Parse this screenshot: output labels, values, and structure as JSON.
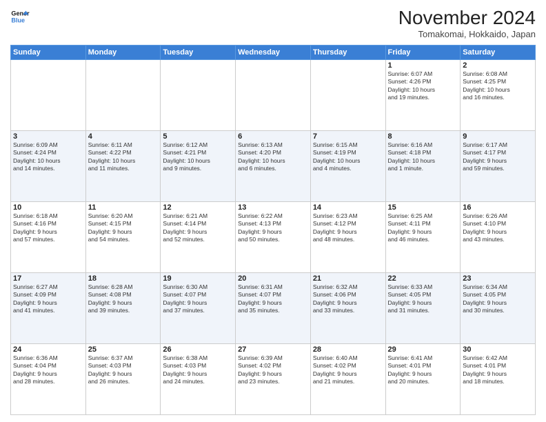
{
  "logo": {
    "line1": "General",
    "line2": "Blue"
  },
  "title": "November 2024",
  "location": "Tomakomai, Hokkaido, Japan",
  "days_of_week": [
    "Sunday",
    "Monday",
    "Tuesday",
    "Wednesday",
    "Thursday",
    "Friday",
    "Saturday"
  ],
  "weeks": [
    [
      {
        "day": "",
        "info": ""
      },
      {
        "day": "",
        "info": ""
      },
      {
        "day": "",
        "info": ""
      },
      {
        "day": "",
        "info": ""
      },
      {
        "day": "",
        "info": ""
      },
      {
        "day": "1",
        "info": "Sunrise: 6:07 AM\nSunset: 4:26 PM\nDaylight: 10 hours\nand 19 minutes."
      },
      {
        "day": "2",
        "info": "Sunrise: 6:08 AM\nSunset: 4:25 PM\nDaylight: 10 hours\nand 16 minutes."
      }
    ],
    [
      {
        "day": "3",
        "info": "Sunrise: 6:09 AM\nSunset: 4:24 PM\nDaylight: 10 hours\nand 14 minutes."
      },
      {
        "day": "4",
        "info": "Sunrise: 6:11 AM\nSunset: 4:22 PM\nDaylight: 10 hours\nand 11 minutes."
      },
      {
        "day": "5",
        "info": "Sunrise: 6:12 AM\nSunset: 4:21 PM\nDaylight: 10 hours\nand 9 minutes."
      },
      {
        "day": "6",
        "info": "Sunrise: 6:13 AM\nSunset: 4:20 PM\nDaylight: 10 hours\nand 6 minutes."
      },
      {
        "day": "7",
        "info": "Sunrise: 6:15 AM\nSunset: 4:19 PM\nDaylight: 10 hours\nand 4 minutes."
      },
      {
        "day": "8",
        "info": "Sunrise: 6:16 AM\nSunset: 4:18 PM\nDaylight: 10 hours\nand 1 minute."
      },
      {
        "day": "9",
        "info": "Sunrise: 6:17 AM\nSunset: 4:17 PM\nDaylight: 9 hours\nand 59 minutes."
      }
    ],
    [
      {
        "day": "10",
        "info": "Sunrise: 6:18 AM\nSunset: 4:16 PM\nDaylight: 9 hours\nand 57 minutes."
      },
      {
        "day": "11",
        "info": "Sunrise: 6:20 AM\nSunset: 4:15 PM\nDaylight: 9 hours\nand 54 minutes."
      },
      {
        "day": "12",
        "info": "Sunrise: 6:21 AM\nSunset: 4:14 PM\nDaylight: 9 hours\nand 52 minutes."
      },
      {
        "day": "13",
        "info": "Sunrise: 6:22 AM\nSunset: 4:13 PM\nDaylight: 9 hours\nand 50 minutes."
      },
      {
        "day": "14",
        "info": "Sunrise: 6:23 AM\nSunset: 4:12 PM\nDaylight: 9 hours\nand 48 minutes."
      },
      {
        "day": "15",
        "info": "Sunrise: 6:25 AM\nSunset: 4:11 PM\nDaylight: 9 hours\nand 46 minutes."
      },
      {
        "day": "16",
        "info": "Sunrise: 6:26 AM\nSunset: 4:10 PM\nDaylight: 9 hours\nand 43 minutes."
      }
    ],
    [
      {
        "day": "17",
        "info": "Sunrise: 6:27 AM\nSunset: 4:09 PM\nDaylight: 9 hours\nand 41 minutes."
      },
      {
        "day": "18",
        "info": "Sunrise: 6:28 AM\nSunset: 4:08 PM\nDaylight: 9 hours\nand 39 minutes."
      },
      {
        "day": "19",
        "info": "Sunrise: 6:30 AM\nSunset: 4:07 PM\nDaylight: 9 hours\nand 37 minutes."
      },
      {
        "day": "20",
        "info": "Sunrise: 6:31 AM\nSunset: 4:07 PM\nDaylight: 9 hours\nand 35 minutes."
      },
      {
        "day": "21",
        "info": "Sunrise: 6:32 AM\nSunset: 4:06 PM\nDaylight: 9 hours\nand 33 minutes."
      },
      {
        "day": "22",
        "info": "Sunrise: 6:33 AM\nSunset: 4:05 PM\nDaylight: 9 hours\nand 31 minutes."
      },
      {
        "day": "23",
        "info": "Sunrise: 6:34 AM\nSunset: 4:05 PM\nDaylight: 9 hours\nand 30 minutes."
      }
    ],
    [
      {
        "day": "24",
        "info": "Sunrise: 6:36 AM\nSunset: 4:04 PM\nDaylight: 9 hours\nand 28 minutes."
      },
      {
        "day": "25",
        "info": "Sunrise: 6:37 AM\nSunset: 4:03 PM\nDaylight: 9 hours\nand 26 minutes."
      },
      {
        "day": "26",
        "info": "Sunrise: 6:38 AM\nSunset: 4:03 PM\nDaylight: 9 hours\nand 24 minutes."
      },
      {
        "day": "27",
        "info": "Sunrise: 6:39 AM\nSunset: 4:02 PM\nDaylight: 9 hours\nand 23 minutes."
      },
      {
        "day": "28",
        "info": "Sunrise: 6:40 AM\nSunset: 4:02 PM\nDaylight: 9 hours\nand 21 minutes."
      },
      {
        "day": "29",
        "info": "Sunrise: 6:41 AM\nSunset: 4:01 PM\nDaylight: 9 hours\nand 20 minutes."
      },
      {
        "day": "30",
        "info": "Sunrise: 6:42 AM\nSunset: 4:01 PM\nDaylight: 9 hours\nand 18 minutes."
      }
    ]
  ]
}
